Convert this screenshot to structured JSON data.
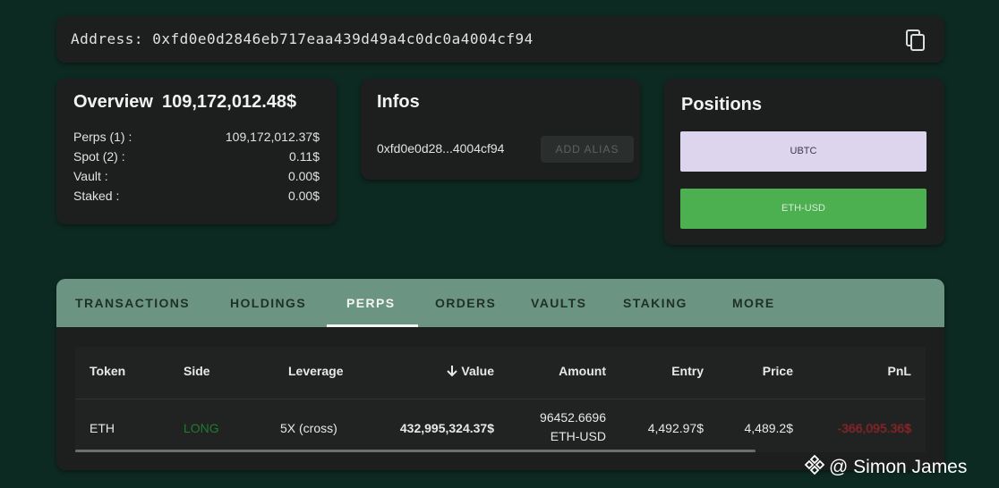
{
  "address_bar": {
    "label": "Address:",
    "address": "0xfd0e0d2846eb717eaa439d49a4c0dc0a4004cf94",
    "copy_icon": "copy-icon"
  },
  "overview": {
    "title": "Overview",
    "total": "109,172,012.48$",
    "rows": [
      {
        "label": "Perps (1) :",
        "value": "109,172,012.37$"
      },
      {
        "label": "Spot (2) :",
        "value": "0.11$"
      },
      {
        "label": "Vault :",
        "value": "0.00$"
      },
      {
        "label": "Staked :",
        "value": "0.00$"
      }
    ]
  },
  "infos": {
    "title": "Infos",
    "address_short": "0xfd0e0d28...4004cf94",
    "alias_button": "ADD ALIAS"
  },
  "positions": {
    "title": "Positions",
    "items": [
      "UBTC",
      "ETH-USD"
    ]
  },
  "tabs": [
    {
      "label": "TRANSACTIONS",
      "active": false
    },
    {
      "label": "HOLDINGS",
      "active": false
    },
    {
      "label": "PERPS",
      "active": true
    },
    {
      "label": "ORDERS",
      "active": false
    },
    {
      "label": "VAULTS",
      "active": false
    },
    {
      "label": "STAKING",
      "active": false
    },
    {
      "label": "MORE",
      "active": false
    }
  ],
  "table": {
    "headers": [
      "Token",
      "Side",
      "Leverage",
      "Value",
      "Amount",
      "Entry",
      "Price",
      "PnL"
    ],
    "sort_icon": "arrow-down-icon",
    "rows": [
      {
        "token": "ETH",
        "side": "LONG",
        "leverage": "5X (cross)",
        "value": "432,995,324.37$",
        "amount_line1": "96452.6696",
        "amount_line2": "ETH-USD",
        "entry": "4,492.97$",
        "price": "4,489.2$",
        "pnl": "-366,095.36$"
      }
    ]
  },
  "watermark": {
    "text": "@ Simon James",
    "icon": "binance-logo-icon"
  },
  "colors": {
    "background": "#0d2a22",
    "card": "#1c1f1e",
    "tab_bar": "#6b9582",
    "long_green": "#1f7a35",
    "pnl_red": "#b3262b",
    "ubtc_button": "#ddd4ee",
    "ethusd_button": "#4caf50"
  }
}
